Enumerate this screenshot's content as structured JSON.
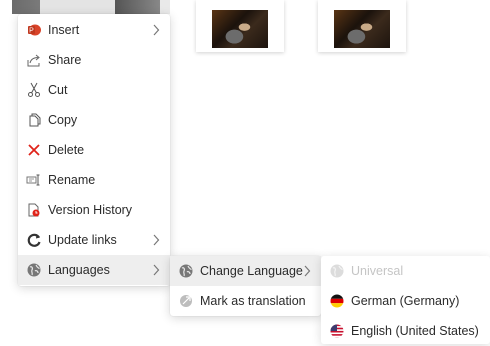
{
  "main_menu": {
    "items": [
      {
        "label": "Insert",
        "icon": "insert-icon"
      },
      {
        "label": "Share",
        "icon": "share-icon"
      },
      {
        "label": "Cut",
        "icon": "scissors-icon"
      },
      {
        "label": "Copy",
        "icon": "copy-icon"
      },
      {
        "label": "Delete",
        "icon": "delete-icon"
      },
      {
        "label": "Rename",
        "icon": "rename-icon"
      },
      {
        "label": "Version History",
        "icon": "version-history-icon"
      },
      {
        "label": "Update links",
        "icon": "refresh-icon"
      },
      {
        "label": "Languages",
        "icon": "globe-icon"
      }
    ]
  },
  "languages_submenu": {
    "items": [
      {
        "label": "Change Language",
        "icon": "globe-icon"
      },
      {
        "label": "Mark as translation",
        "icon": "translation-icon"
      }
    ]
  },
  "language_options": {
    "items": [
      {
        "label": "Universal",
        "icon": "globe-icon",
        "disabled": true
      },
      {
        "label": "German (Germany)",
        "icon": "german-flag-icon"
      },
      {
        "label": "English (United States)",
        "icon": "us-flag-icon"
      }
    ]
  },
  "colors": {
    "delete_red": "#e0231a",
    "insert_orange": "#d9442a",
    "hover_gray": "#eeeeee"
  }
}
